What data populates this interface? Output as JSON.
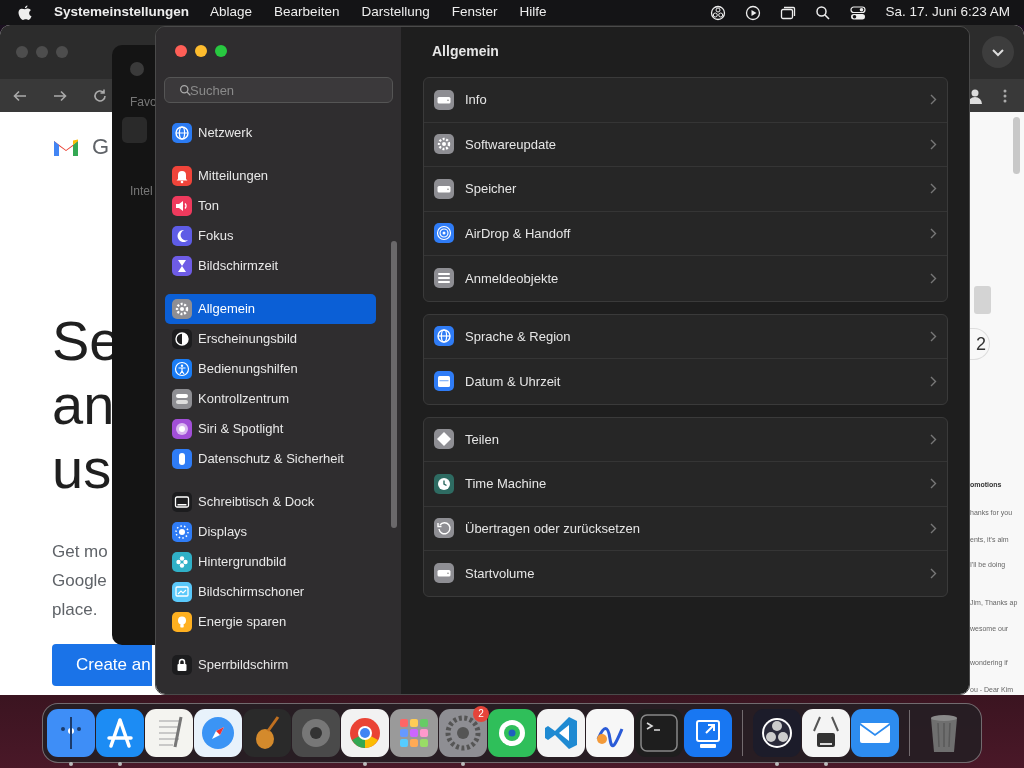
{
  "menubar": {
    "app_name": "Systemeinstellungen",
    "menus": [
      "Ablage",
      "Bearbeiten",
      "Darstellung",
      "Fenster",
      "Hilfe"
    ],
    "clock": "Sa. 17. Juni 6:23 AM"
  },
  "browser": {
    "brand_text": "G",
    "headline": [
      "Se",
      "an",
      "us"
    ],
    "body_lines": [
      "Get mo",
      "Google",
      "place."
    ],
    "cta": "Create an",
    "counter": "2",
    "snippets": [
      "omotions",
      "hanks for you",
      "ents, it's alm",
      "I'll be doing",
      "Jim, Thanks ap",
      "wesome our",
      "wondering if",
      "ou - Dear Kim"
    ]
  },
  "side_window": {
    "labels": [
      "Favo",
      "Intel"
    ]
  },
  "settings": {
    "search": {
      "placeholder": "Suchen"
    },
    "sidebar": [
      {
        "items": [
          {
            "label": "Netzwerk",
            "selected": false,
            "color": "#2b7bf3"
          }
        ]
      },
      {
        "items": [
          {
            "label": "Mitteilungen",
            "selected": false,
            "color": "#f0443a"
          },
          {
            "label": "Ton",
            "selected": false,
            "color": "#ef3a5d"
          },
          {
            "label": "Fokus",
            "selected": false,
            "color": "#5e5ce6"
          },
          {
            "label": "Bildschirmzeit",
            "selected": false,
            "color": "#6e5ce6"
          }
        ]
      },
      {
        "items": [
          {
            "label": "Allgemein",
            "selected": true,
            "color": "#8e8e93"
          },
          {
            "label": "Erscheinungsbild",
            "selected": false,
            "color": "#1c1c1e"
          },
          {
            "label": "Bedienungshilfen",
            "selected": false,
            "color": "#1a7cf5"
          },
          {
            "label": "Kontrollzentrum",
            "selected": false,
            "color": "#8e8e93"
          },
          {
            "label": "Siri & Spotlight",
            "selected": false,
            "color": "#a24fd8"
          },
          {
            "label": "Datenschutz & Sicherheit",
            "selected": false,
            "color": "#2f7cf6"
          }
        ]
      },
      {
        "items": [
          {
            "label": "Schreibtisch & Dock",
            "selected": false,
            "color": "#1c1c1e"
          },
          {
            "label": "Displays",
            "selected": false,
            "color": "#2f7cf6"
          },
          {
            "label": "Hintergrundbild",
            "selected": false,
            "color": "#30b0c7"
          },
          {
            "label": "Bildschirmschoner",
            "selected": false,
            "color": "#5ac8fa"
          },
          {
            "label": "Energie sparen",
            "selected": false,
            "color": "#ffb020"
          }
        ]
      },
      {
        "items": [
          {
            "label": "Sperrbildschirm",
            "selected": false,
            "color": "#1c1c1e"
          }
        ]
      }
    ],
    "title": "Allgemein",
    "sections": [
      {
        "rows": [
          {
            "label": "Info",
            "color": "#8e8e93"
          },
          {
            "label": "Softwareupdate",
            "color": "#8e8e93"
          },
          {
            "label": "Speicher",
            "color": "#8e8e93"
          },
          {
            "label": "AirDrop & Handoff",
            "color": "#2f7cf6"
          },
          {
            "label": "Anmeldeobjekte",
            "color": "#8e8e93"
          }
        ]
      },
      {
        "rows": [
          {
            "label": "Sprache & Region",
            "color": "#2f7cf6"
          },
          {
            "label": "Datum & Uhrzeit",
            "color": "#2f7cf6"
          }
        ]
      },
      {
        "rows": [
          {
            "label": "Teilen",
            "color": "#8e8e93"
          },
          {
            "label": "Time Machine",
            "color": "#2e6b62"
          },
          {
            "label": "Übertragen oder zurücksetzen",
            "color": "#8e8e93"
          },
          {
            "label": "Startvolume",
            "color": "#8e8e93"
          }
        ]
      }
    ]
  },
  "dock": {
    "apps": [
      {
        "kind": "app",
        "color": "#3e8ef7",
        "running": true
      },
      {
        "kind": "app",
        "color": "#1c8cf4",
        "running": true
      },
      {
        "kind": "app",
        "color": "#f4f4f0",
        "running": false
      },
      {
        "kind": "app",
        "color": "#e8f2fb",
        "running": false
      },
      {
        "kind": "app",
        "color": "#2a2a2a",
        "running": false
      },
      {
        "kind": "app",
        "color": "#4a4a4a",
        "running": false
      },
      {
        "kind": "app",
        "color": "#f2f2f2",
        "running": true
      },
      {
        "kind": "app",
        "color": "#9a9a9a",
        "running": false
      },
      {
        "kind": "app",
        "color": "#8e8e93",
        "running": true,
        "badge": "2"
      },
      {
        "kind": "app",
        "color": "#2fbf5a",
        "running": false
      },
      {
        "kind": "app",
        "color": "#f4f4f4",
        "running": false
      },
      {
        "kind": "app",
        "color": "#f7f7f7",
        "running": false
      },
      {
        "kind": "app",
        "color": "#1e1e1e",
        "running": false
      },
      {
        "kind": "app",
        "color": "#1877f2",
        "running": false
      },
      {
        "kind": "separator"
      },
      {
        "kind": "app",
        "color": "#1c1c2a",
        "running": true
      },
      {
        "kind": "app",
        "color": "#f4f4f4",
        "running": true
      },
      {
        "kind": "app",
        "color": "#2d8cf0",
        "running": false
      },
      {
        "kind": "separator"
      },
      {
        "kind": "trash",
        "running": false
      }
    ]
  }
}
